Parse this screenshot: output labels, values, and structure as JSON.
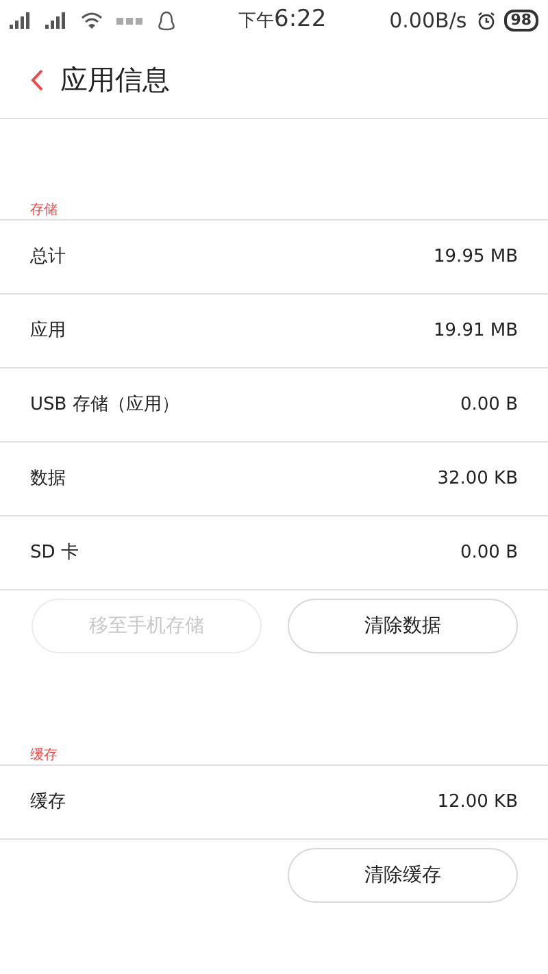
{
  "status_bar": {
    "time_prefix": "下午",
    "time": "6:22",
    "speed": "0.00B/s",
    "battery": "98"
  },
  "header": {
    "title": "应用信息"
  },
  "sections": [
    {
      "label": "存储",
      "rows": [
        {
          "label": "总计",
          "value": "19.95 MB"
        },
        {
          "label": "应用",
          "value": "19.91 MB"
        },
        {
          "label": "USB 存储（应用）",
          "value": "0.00 B"
        },
        {
          "label": "数据",
          "value": "32.00 KB"
        },
        {
          "label": "SD 卡",
          "value": "0.00 B"
        }
      ],
      "buttons": [
        {
          "label": "移至手机存储",
          "disabled": true
        },
        {
          "label": "清除数据",
          "disabled": false
        }
      ]
    },
    {
      "label": "缓存",
      "rows": [
        {
          "label": "缓存",
          "value": "12.00 KB"
        }
      ],
      "buttons": [
        {
          "label": "清除缓存",
          "disabled": false
        }
      ]
    }
  ]
}
